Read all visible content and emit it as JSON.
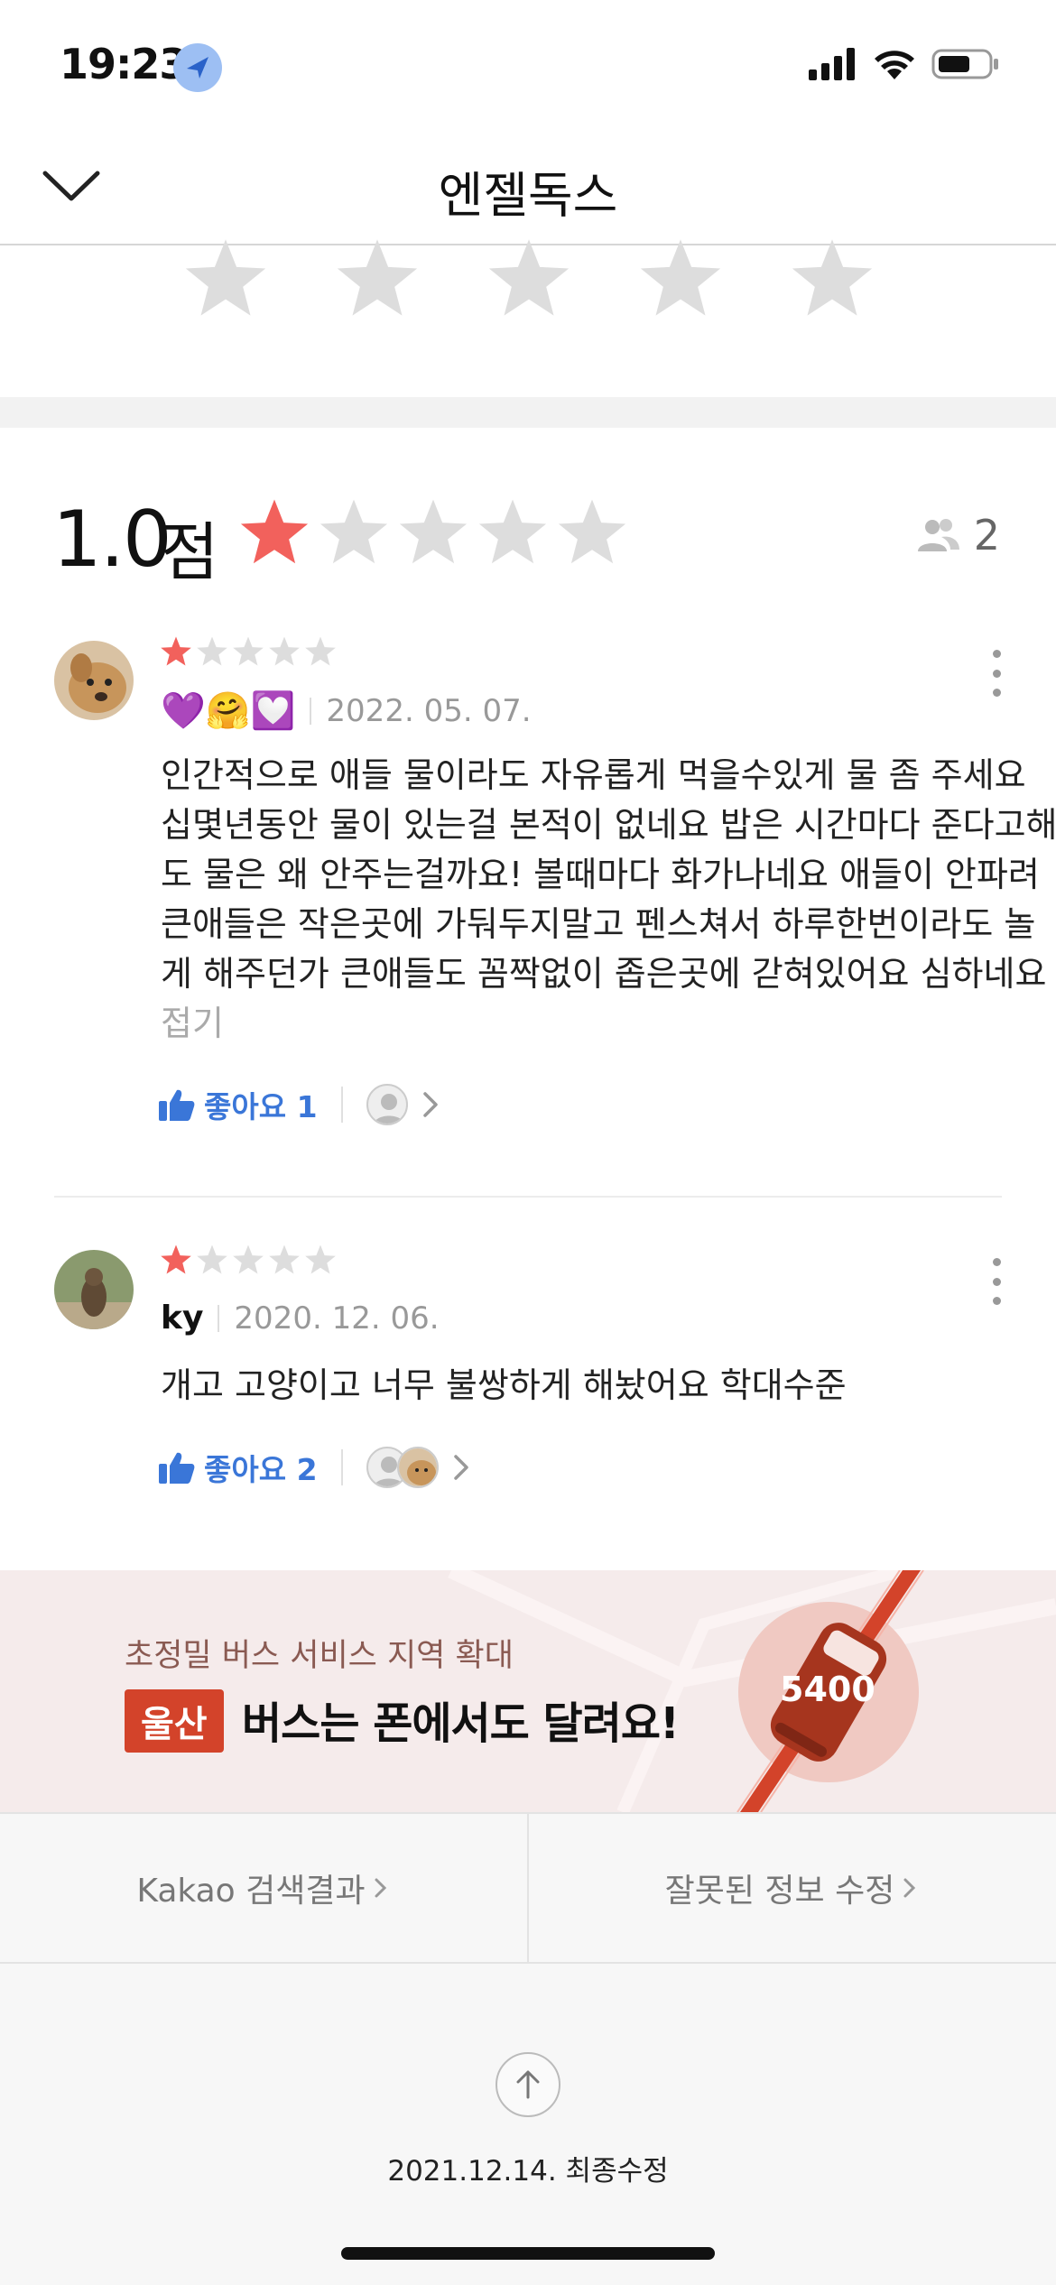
{
  "status_bar": {
    "time": "19:23"
  },
  "header": {
    "title": "엔젤독스"
  },
  "summary": {
    "score": "1.0",
    "score_unit": "점",
    "rating_stars": 1,
    "reviewer_count": "2"
  },
  "reviews": [
    {
      "rating": 1,
      "author_emoji": "💜🤗💟",
      "date": "2022. 05. 07.",
      "body": "인간적으로  애들 물이라도 자유롭게 먹을수있게 물 좀 주세요 십몇년동안  물이 있는걸 본적이 없네요  밥은  시간마다 준다고해도 물은 왜 안주는걸까요! 볼때마다  화가나네요  애들이 안파려  큰애들은  작은곳에 가둬두지말고 펜스쳐서  하루한번이라도  놀게 해주던가  큰애들도  꼼짝없이 좁은곳에 갇혀있어요  심하네요",
      "fold_label": "접기",
      "like_label": "좋아요 1"
    },
    {
      "rating": 1,
      "author": "ky",
      "date": "2020. 12. 06.",
      "body": "개고 고양이고 너무 불쌍하게 해놨어요 학대수준",
      "like_label": "좋아요 2"
    }
  ],
  "banner": {
    "subtitle": "초정밀 버스 서비스 지역 확대",
    "tag": "울산",
    "headline": "버스는 폰에서도 달려요!",
    "bus_number": "5400"
  },
  "footer": {
    "search_link": "Kakao 검색결과",
    "report_link": "잘못된 정보 수정",
    "updated": "2021.12.14. 최종수정"
  },
  "colors": {
    "star_filled": "#f2615c",
    "star_empty": "#dddddd",
    "like_blue": "#3a76d8",
    "banner_tag": "#d3432a"
  }
}
